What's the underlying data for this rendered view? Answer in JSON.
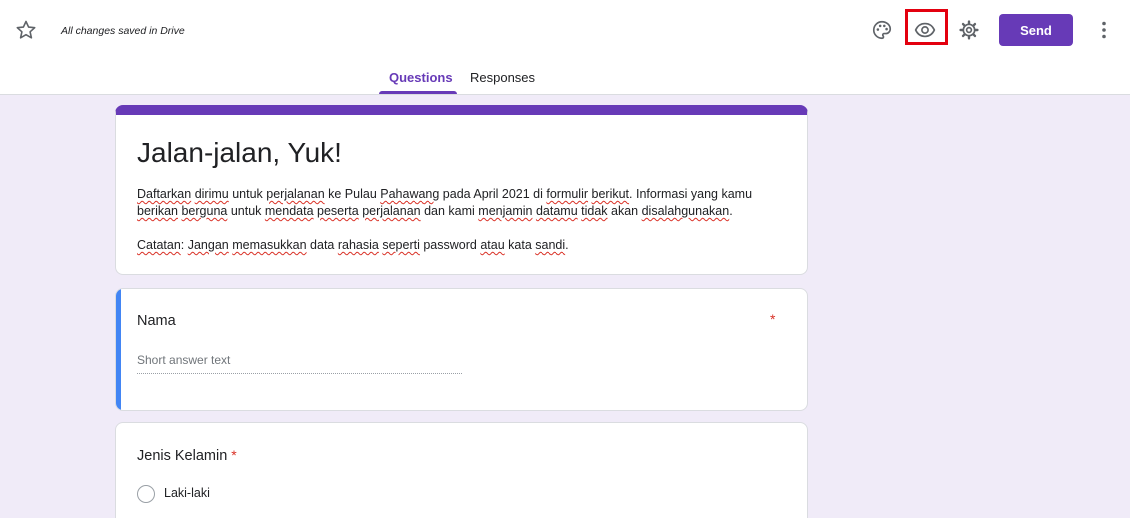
{
  "header": {
    "saved_status": "All changes saved in Drive",
    "send_label": "Send",
    "icons": [
      "star-icon",
      "palette-icon",
      "eye-icon",
      "gear-icon",
      "more-vert-icon"
    ]
  },
  "tabs": [
    {
      "label": "Questions",
      "active": true
    },
    {
      "label": "Responses",
      "active": false
    }
  ],
  "form": {
    "title": "Jalan-jalan, Yuk!",
    "description": {
      "p1": {
        "s1": "Daftarkan",
        "s2": " ",
        "s3": "dirimu",
        "s4": " untuk ",
        "s5": "perjalanan",
        "s6": " ke Pulau ",
        "s7": "Pahawang",
        "s8": " pada April 2021 di ",
        "s9": "formulir",
        "s10": " ",
        "s11": "berikut",
        "s12": ". Informasi yang kamu ",
        "s13": "berikan",
        "s14": " ",
        "s15": "berguna",
        "s16": " untuk ",
        "s17": "mendata",
        "s18": " ",
        "s19": "peserta",
        "s20": " ",
        "s21": "perjalanan",
        "s22": " dan kami ",
        "s23": "menjamin",
        "s24": " ",
        "s25": "datamu",
        "s26": " ",
        "s27": "tidak",
        "s28": " akan ",
        "s29": "disalahgunakan",
        "s30": "."
      },
      "p2": {
        "s1": "Catatan",
        "s2": ": ",
        "s3": "Jangan",
        "s4": " ",
        "s5": "memasukkan",
        "s6": " data ",
        "s7": "rahasia",
        "s8": " ",
        "s9": "seperti",
        "s10": " password ",
        "s11": "atau",
        "s12": " kata ",
        "s13": "sandi",
        "s14": "."
      }
    }
  },
  "questions": [
    {
      "label": "Nama",
      "required_mark": "*",
      "placeholder": "Short answer text"
    },
    {
      "label": "Jenis Kelamin",
      "required_mark": "*",
      "options": [
        "Laki-laki"
      ]
    }
  ],
  "colors": {
    "accent": "#673ab7",
    "background": "#f0ebf8",
    "active_question": "#4285f4",
    "required": "#d93025",
    "highlight": "#e3000f"
  }
}
